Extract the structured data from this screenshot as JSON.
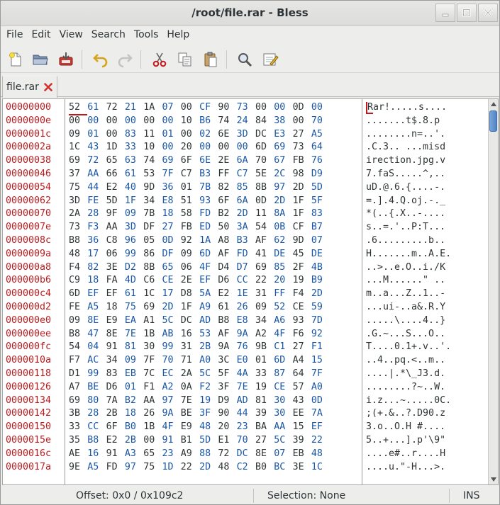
{
  "window": {
    "title": "/root/file.rar - Bless"
  },
  "menu": [
    "File",
    "Edit",
    "View",
    "Search",
    "Tools",
    "Help"
  ],
  "toolbar": {
    "icons": [
      "new-file-icon",
      "open-folder-icon",
      "save-icon",
      "undo-icon",
      "redo-icon",
      "cut-icon",
      "copy-icon",
      "paste-icon",
      "find-icon",
      "preferences-icon"
    ],
    "colors": {
      "accent": "#c0191c",
      "odd_byte": "#1a57a5",
      "text": "#2e3436"
    }
  },
  "tab": {
    "label": "file.rar"
  },
  "hexview": {
    "rows": [
      {
        "offset": "00000000",
        "bytes": [
          "52",
          "61",
          "72",
          "21",
          "1A",
          "07",
          "00",
          "CF",
          "90",
          "73",
          "00",
          "00",
          "0D",
          "00"
        ],
        "ascii": "Rar!.....s...."
      },
      {
        "offset": "0000000e",
        "bytes": [
          "00",
          "00",
          "00",
          "00",
          "00",
          "00",
          "10",
          "B6",
          "74",
          "24",
          "84",
          "38",
          "00",
          "70"
        ],
        "ascii": ".......t$.8.p"
      },
      {
        "offset": "0000001c",
        "bytes": [
          "09",
          "01",
          "00",
          "83",
          "11",
          "01",
          "00",
          "02",
          "6E",
          "3D",
          "DC",
          "E3",
          "27",
          "A5"
        ],
        "ascii": "........n=..'."
      },
      {
        "offset": "0000002a",
        "bytes": [
          "1C",
          "43",
          "1D",
          "33",
          "10",
          "00",
          "20",
          "00",
          "00",
          "00",
          "6D",
          "69",
          "73",
          "64"
        ],
        "ascii": ".C.3.. ...misd"
      },
      {
        "offset": "00000038",
        "bytes": [
          "69",
          "72",
          "65",
          "63",
          "74",
          "69",
          "6F",
          "6E",
          "2E",
          "6A",
          "70",
          "67",
          "FB",
          "76"
        ],
        "ascii": "irection.jpg.v"
      },
      {
        "offset": "00000046",
        "bytes": [
          "37",
          "AA",
          "66",
          "61",
          "53",
          "7F",
          "C7",
          "B3",
          "FF",
          "C7",
          "5E",
          "2C",
          "98",
          "D9"
        ],
        "ascii": "7.faS.....^,.."
      },
      {
        "offset": "00000054",
        "bytes": [
          "75",
          "44",
          "E2",
          "40",
          "9D",
          "36",
          "01",
          "7B",
          "82",
          "85",
          "8B",
          "97",
          "2D",
          "5D"
        ],
        "ascii": "uD.@.6.{....-."
      },
      {
        "offset": "00000062",
        "bytes": [
          "3D",
          "FE",
          "5D",
          "1F",
          "34",
          "E8",
          "51",
          "93",
          "6F",
          "6A",
          "0D",
          "2D",
          "1F",
          "5F"
        ],
        "ascii": "=.].4.Q.oj.-._"
      },
      {
        "offset": "00000070",
        "bytes": [
          "2A",
          "28",
          "9F",
          "09",
          "7B",
          "18",
          "58",
          "FD",
          "B2",
          "2D",
          "11",
          "8A",
          "1F",
          "83"
        ],
        "ascii": "*(..{.X..-...."
      },
      {
        "offset": "0000007e",
        "bytes": [
          "73",
          "F3",
          "AA",
          "3D",
          "DF",
          "27",
          "FB",
          "ED",
          "50",
          "3A",
          "54",
          "0B",
          "CF",
          "B7"
        ],
        "ascii": "s..=.'..P:T..."
      },
      {
        "offset": "0000008c",
        "bytes": [
          "B8",
          "36",
          "C8",
          "96",
          "05",
          "0D",
          "92",
          "1A",
          "A8",
          "B3",
          "AF",
          "62",
          "9D",
          "07"
        ],
        "ascii": ".6.........b.."
      },
      {
        "offset": "0000009a",
        "bytes": [
          "48",
          "17",
          "06",
          "99",
          "86",
          "DF",
          "09",
          "6D",
          "AF",
          "FD",
          "41",
          "DE",
          "45",
          "DE"
        ],
        "ascii": "H.......m..A.E."
      },
      {
        "offset": "000000a8",
        "bytes": [
          "F4",
          "82",
          "3E",
          "D2",
          "8B",
          "65",
          "06",
          "4F",
          "D4",
          "D7",
          "69",
          "85",
          "2F",
          "4B"
        ],
        "ascii": "..>..e.O..i./K"
      },
      {
        "offset": "000000b6",
        "bytes": [
          "C9",
          "18",
          "FA",
          "4D",
          "C6",
          "CE",
          "2E",
          "EF",
          "D6",
          "CC",
          "22",
          "20",
          "19",
          "B9"
        ],
        "ascii": "...M......\" .."
      },
      {
        "offset": "000000c4",
        "bytes": [
          "6D",
          "EF",
          "EF",
          "61",
          "1C",
          "17",
          "D8",
          "5A",
          "E2",
          "1E",
          "31",
          "FF",
          "F4",
          "2D"
        ],
        "ascii": "m..a...Z..1..-"
      },
      {
        "offset": "000000d2",
        "bytes": [
          "FE",
          "A5",
          "18",
          "75",
          "69",
          "2D",
          "1F",
          "A9",
          "61",
          "26",
          "09",
          "52",
          "CE",
          "59"
        ],
        "ascii": "...ui-..a&.R.Y"
      },
      {
        "offset": "000000e0",
        "bytes": [
          "09",
          "8E",
          "E9",
          "EA",
          "A1",
          "5C",
          "DC",
          "AD",
          "B8",
          "E8",
          "34",
          "A6",
          "93",
          "7D"
        ],
        "ascii": ".....\\....4..}"
      },
      {
        "offset": "000000ee",
        "bytes": [
          "B8",
          "47",
          "8E",
          "7E",
          "1B",
          "AB",
          "16",
          "53",
          "AF",
          "9A",
          "A2",
          "4F",
          "F6",
          "92"
        ],
        "ascii": ".G.~...S...O.."
      },
      {
        "offset": "000000fc",
        "bytes": [
          "54",
          "04",
          "91",
          "81",
          "30",
          "99",
          "31",
          "2B",
          "9A",
          "76",
          "9B",
          "C1",
          "27",
          "F1"
        ],
        "ascii": "T....0.1+.v..'."
      },
      {
        "offset": "0000010a",
        "bytes": [
          "F7",
          "AC",
          "34",
          "09",
          "7F",
          "70",
          "71",
          "A0",
          "3C",
          "E0",
          "01",
          "6D",
          "A4",
          "15"
        ],
        "ascii": "..4..pq.<..m.."
      },
      {
        "offset": "00000118",
        "bytes": [
          "D1",
          "99",
          "83",
          "EB",
          "7C",
          "EC",
          "2A",
          "5C",
          "5F",
          "4A",
          "33",
          "87",
          "64",
          "7F"
        ],
        "ascii": "....|.*\\_J3.d."
      },
      {
        "offset": "00000126",
        "bytes": [
          "A7",
          "BE",
          "D6",
          "01",
          "F1",
          "A2",
          "0A",
          "F2",
          "3F",
          "7E",
          "19",
          "CE",
          "57",
          "A0"
        ],
        "ascii": "........?~..W."
      },
      {
        "offset": "00000134",
        "bytes": [
          "69",
          "80",
          "7A",
          "B2",
          "AA",
          "97",
          "7E",
          "19",
          "D9",
          "AD",
          "81",
          "30",
          "43",
          "0D"
        ],
        "ascii": "i.z...~.....0C."
      },
      {
        "offset": "00000142",
        "bytes": [
          "3B",
          "28",
          "2B",
          "18",
          "26",
          "9A",
          "BE",
          "3F",
          "90",
          "44",
          "39",
          "30",
          "EE",
          "7A"
        ],
        "ascii": ";(+.&..?.D90.z"
      },
      {
        "offset": "00000150",
        "bytes": [
          "33",
          "CC",
          "6F",
          "B0",
          "1B",
          "4F",
          "E9",
          "48",
          "20",
          "23",
          "BA",
          "AA",
          "15",
          "EF"
        ],
        "ascii": "3.o..O.H #...."
      },
      {
        "offset": "0000015e",
        "bytes": [
          "35",
          "B8",
          "E2",
          "2B",
          "00",
          "91",
          "B1",
          "5D",
          "E1",
          "70",
          "27",
          "5C",
          "39",
          "22"
        ],
        "ascii": "5..+...].p'\\9\""
      },
      {
        "offset": "0000016c",
        "bytes": [
          "AE",
          "16",
          "91",
          "A3",
          "65",
          "23",
          "A9",
          "88",
          "72",
          "DC",
          "8E",
          "07",
          "EB",
          "48"
        ],
        "ascii": "....e#..r....H"
      },
      {
        "offset": "0000017a",
        "bytes": [
          "9E",
          "A5",
          "FD",
          "97",
          "75",
          "1D",
          "22",
          "2D",
          "48",
          "C2",
          "B0",
          "BC",
          "3E",
          "1C"
        ],
        "ascii": "....u.\"-H...>."
      }
    ]
  },
  "status": {
    "offset": "Offset: 0x0 / 0x109c2",
    "selection": "Selection: None",
    "mode": "INS"
  }
}
